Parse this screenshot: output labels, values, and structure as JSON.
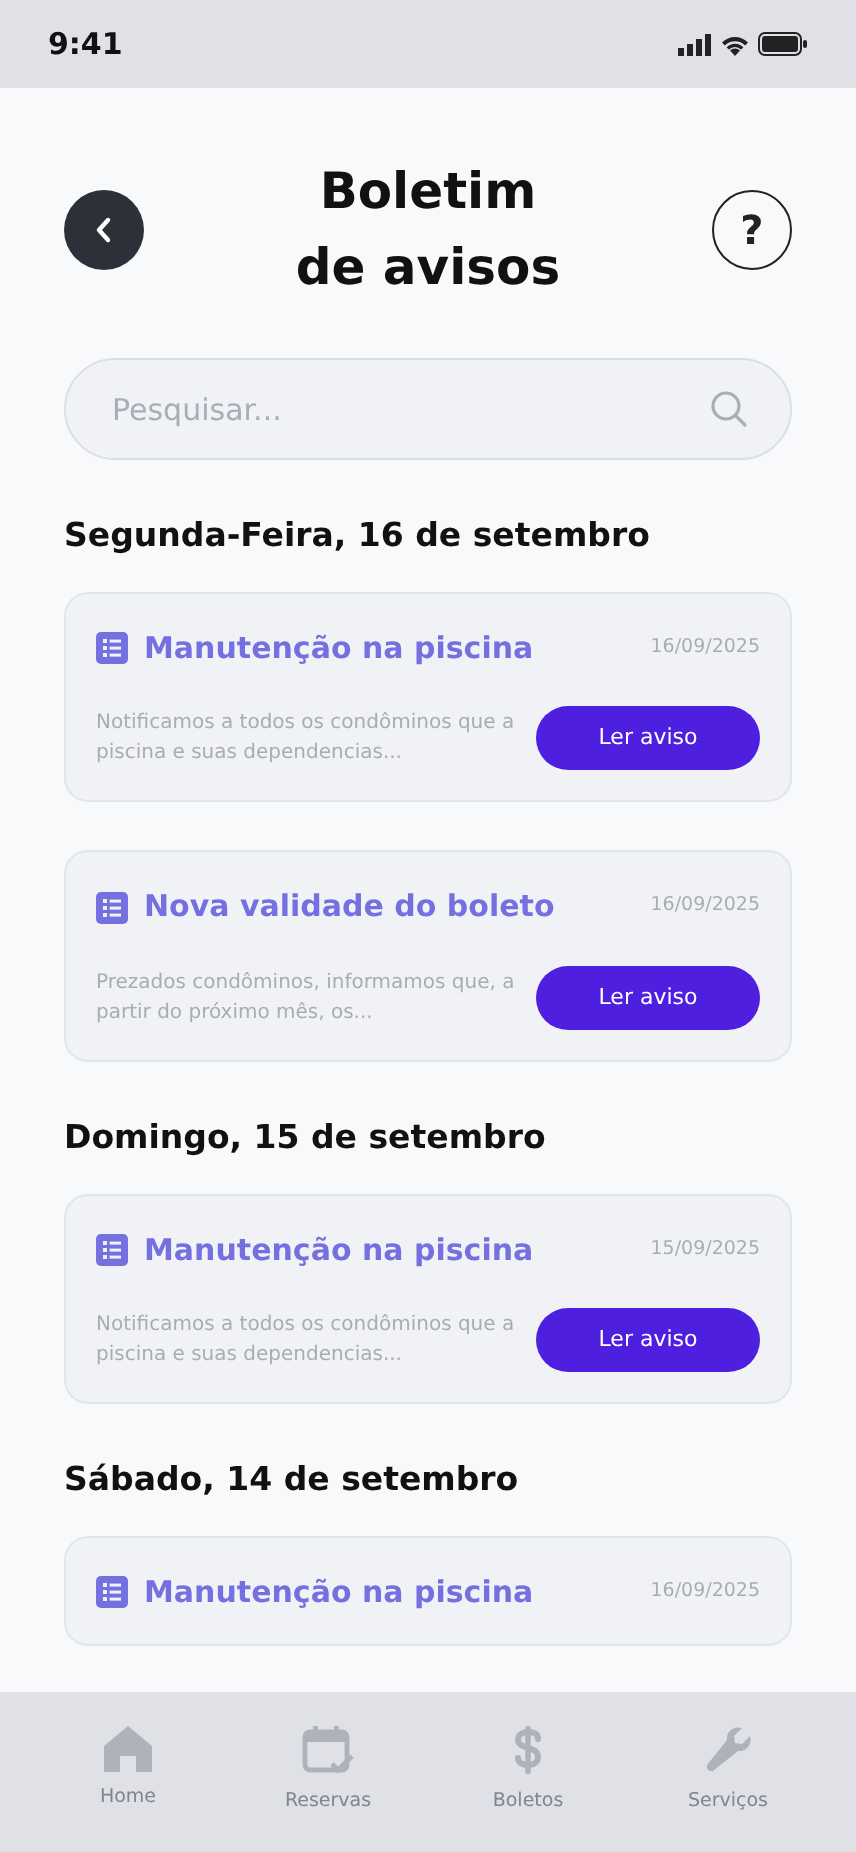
{
  "status_bar": {
    "time": "9:41"
  },
  "header": {
    "title_lines": [
      "Boletim",
      "de avisos"
    ],
    "help_label": "?"
  },
  "search": {
    "placeholder": "Pesquisar..."
  },
  "sections": [
    {
      "heading": "Segunda-Feira, 16 de setembro",
      "notices": [
        {
          "title": "Manutenção na piscina",
          "date": "16/09/2025",
          "excerpt": "Notificamos a todos os condôminos que a piscina e suas dependencias...",
          "button": "Ler aviso"
        },
        {
          "title": "Nova validade do boleto",
          "date": "16/09/2025",
          "excerpt": "Prezados condôminos, informamos que, a partir do próximo mês, os...",
          "button": "Ler aviso"
        }
      ]
    },
    {
      "heading": "Domingo, 15 de setembro",
      "notices": [
        {
          "title": "Manutenção na piscina",
          "date": "15/09/2025",
          "excerpt": "Notificamos a todos os condôminos que a piscina e suas dependencias...",
          "button": "Ler aviso"
        }
      ]
    },
    {
      "heading": "Sábado, 14 de setembro",
      "notices": [
        {
          "title": "Manutenção na piscina",
          "date": "16/09/2025"
        }
      ]
    }
  ],
  "tab_bar": [
    {
      "kind": "home",
      "label": "Home",
      "selected": false
    },
    {
      "kind": "calendar",
      "label": "Reservas",
      "selected": false
    },
    {
      "kind": "dollar",
      "label": "Boletos",
      "selected": false
    },
    {
      "kind": "wrench",
      "label": "Serviços",
      "selected": false
    }
  ]
}
